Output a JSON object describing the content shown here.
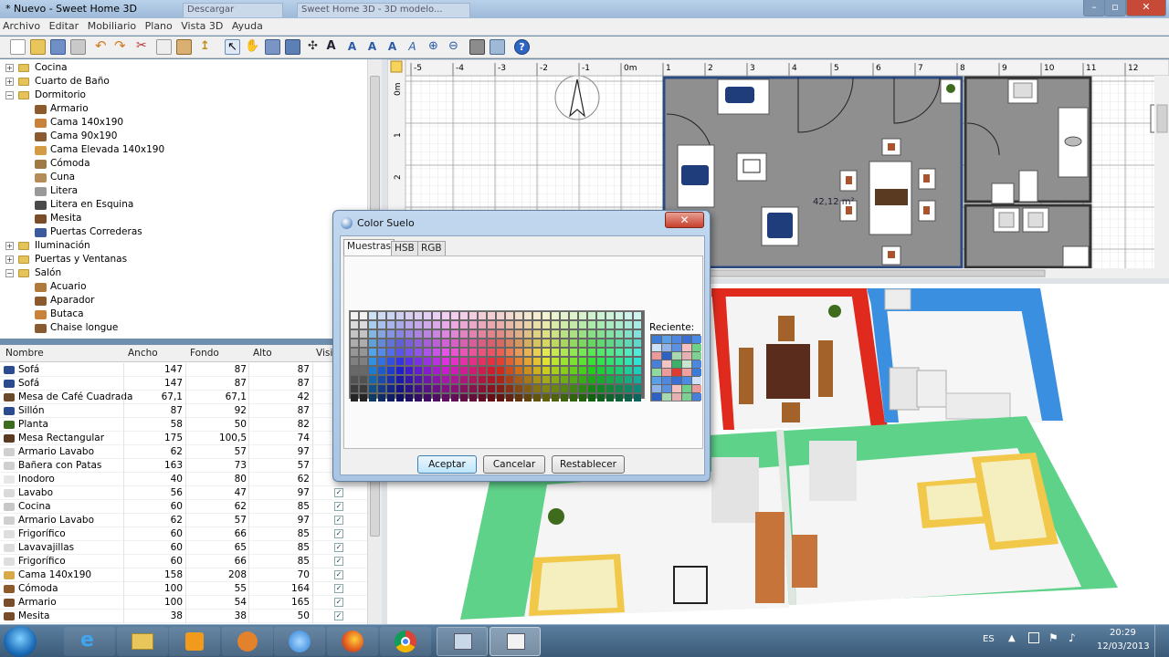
{
  "window": {
    "title": "* Nuevo - Sweet Home 3D",
    "bg_tabs": [
      "Sweet Home 3D - 3D modelo...",
      "Descargar"
    ]
  },
  "menu": [
    "Archivo",
    "Editar",
    "Mobiliario",
    "Plano",
    "Vista 3D",
    "Ayuda"
  ],
  "tree": {
    "items": [
      {
        "label": "Cocina",
        "level": 0,
        "expanded": false
      },
      {
        "label": "Cuarto de Baño",
        "level": 0,
        "expanded": false
      },
      {
        "label": "Dormitorio",
        "level": 0,
        "expanded": true
      },
      {
        "label": "Armario",
        "level": 1
      },
      {
        "label": "Cama 140x190",
        "level": 1
      },
      {
        "label": "Cama 90x190",
        "level": 1
      },
      {
        "label": "Cama Elevada 140x190",
        "level": 1
      },
      {
        "label": "Cómoda",
        "level": 1
      },
      {
        "label": "Cuna",
        "level": 1
      },
      {
        "label": "Litera",
        "level": 1
      },
      {
        "label": "Litera en Esquina",
        "level": 1
      },
      {
        "label": "Mesita",
        "level": 1
      },
      {
        "label": "Puertas Correderas",
        "level": 1
      },
      {
        "label": "Iluminación",
        "level": 0,
        "expanded": false
      },
      {
        "label": "Puertas y Ventanas",
        "level": 0,
        "expanded": false
      },
      {
        "label": "Salón",
        "level": 0,
        "expanded": true
      },
      {
        "label": "Acuario",
        "level": 1
      },
      {
        "label": "Aparador",
        "level": 1
      },
      {
        "label": "Butaca",
        "level": 1
      },
      {
        "label": "Chaise longue",
        "level": 1
      }
    ]
  },
  "table": {
    "columns": [
      "Nombre",
      "Ancho",
      "Fondo",
      "Alto",
      "Visib"
    ],
    "rows": [
      {
        "name": "Sofá",
        "w": "147",
        "d": "87",
        "h": "87",
        "v": false
      },
      {
        "name": "Sofá",
        "w": "147",
        "d": "87",
        "h": "87",
        "v": false
      },
      {
        "name": "Mesa de Café Cuadrada",
        "w": "67,1",
        "d": "67,1",
        "h": "42",
        "v": false
      },
      {
        "name": "Sillón",
        "w": "87",
        "d": "92",
        "h": "87",
        "v": false
      },
      {
        "name": "Planta",
        "w": "58",
        "d": "50",
        "h": "82",
        "v": false
      },
      {
        "name": "Mesa Rectangular",
        "w": "175",
        "d": "100,5",
        "h": "74",
        "v": false
      },
      {
        "name": "Armario Lavabo",
        "w": "62",
        "d": "57",
        "h": "97",
        "v": false
      },
      {
        "name": "Bañera con Patas",
        "w": "163",
        "d": "73",
        "h": "57",
        "v": false
      },
      {
        "name": "Inodoro",
        "w": "40",
        "d": "80",
        "h": "62",
        "v": false
      },
      {
        "name": "Lavabo",
        "w": "56",
        "d": "47",
        "h": "97",
        "v": true
      },
      {
        "name": "Cocina",
        "w": "60",
        "d": "62",
        "h": "85",
        "v": true
      },
      {
        "name": "Armario Lavabo",
        "w": "62",
        "d": "57",
        "h": "97",
        "v": true
      },
      {
        "name": "Frigorífico",
        "w": "60",
        "d": "66",
        "h": "85",
        "v": true
      },
      {
        "name": "Lavavajillas",
        "w": "60",
        "d": "65",
        "h": "85",
        "v": true
      },
      {
        "name": "Frigorífico",
        "w": "60",
        "d": "66",
        "h": "85",
        "v": true
      },
      {
        "name": "Cama 140x190",
        "w": "158",
        "d": "208",
        "h": "70",
        "v": true
      },
      {
        "name": "Cómoda",
        "w": "100",
        "d": "55",
        "h": "164",
        "v": true
      },
      {
        "name": "Armario",
        "w": "100",
        "d": "54",
        "h": "165",
        "v": true
      },
      {
        "name": "Mesita",
        "w": "38",
        "d": "38",
        "h": "50",
        "v": true
      }
    ]
  },
  "plan": {
    "ruler_labels": [
      "-5",
      "-4",
      "-3",
      "-2",
      "-1",
      "0m",
      "1",
      "2",
      "3",
      "4",
      "5",
      "6",
      "7",
      "8",
      "9",
      "10",
      "11",
      "12"
    ],
    "vruler_labels": [
      "0m",
      "1",
      "2"
    ],
    "area_label": "42,12 m²"
  },
  "dialog": {
    "title": "Color Suelo",
    "tabs": [
      "Muestras",
      "HSB",
      "RGB"
    ],
    "recent_label": "Reciente:",
    "buttons": {
      "ok": "Aceptar",
      "cancel": "Cancelar",
      "reset": "Restablecer"
    }
  },
  "taskbar": {
    "lang": "ES",
    "time": "20:29",
    "date": "12/03/2013"
  },
  "colors": {
    "floor_green": "#5fd28a",
    "wall_red": "#e8261c",
    "wall_blue": "#2e8ae0",
    "plan_room": "#8a8a8a",
    "bed_yellow": "#f2c84b"
  }
}
